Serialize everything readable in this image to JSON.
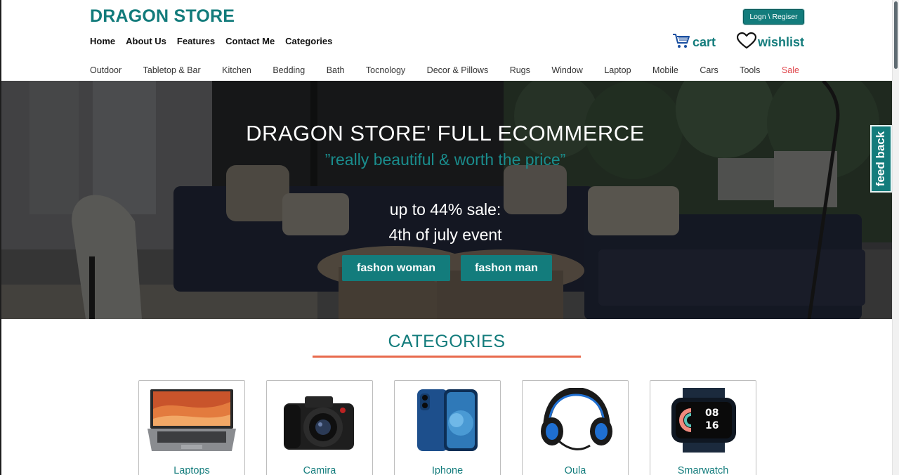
{
  "header": {
    "brand": "DRAGON STORE",
    "login_label": "Logn \\ Regiser",
    "main_nav": [
      "Home",
      "About Us",
      "Features",
      "Contact Me",
      "Categories"
    ],
    "cart_label": "cart",
    "wishlist_label": "wishlist"
  },
  "category_nav": [
    "Outdoor",
    "Tabletop & Bar",
    "Kitchen",
    "Bedding",
    "Bath",
    "Tocnology",
    "Decor & Pillows",
    "Rugs",
    "Window",
    "Laptop",
    "Mobile",
    "Cars",
    "Tools",
    "Sale"
  ],
  "hero": {
    "title": "DRAGON STORE' FULL ECOMMERCE",
    "quote": "”really beautiful & worth the price”",
    "sale_line": "up to 44% sale:",
    "event_line": "4th of july event",
    "btn_woman": "fashon woman",
    "btn_man": "fashon man"
  },
  "feedback_label": "feed back",
  "categories": {
    "title": "CATEGORIES",
    "items": [
      {
        "label": "Laptops",
        "icon": "laptop-image"
      },
      {
        "label": "Camira",
        "icon": "camera-image"
      },
      {
        "label": "Iphone",
        "icon": "phone-image"
      },
      {
        "label": "Oula",
        "icon": "headset-image"
      },
      {
        "label": "Smarwatch",
        "icon": "smartwatch-image"
      }
    ]
  },
  "colors": {
    "accent": "#137c7c",
    "sale": "#e0474c",
    "underline": "#e86a4d"
  }
}
